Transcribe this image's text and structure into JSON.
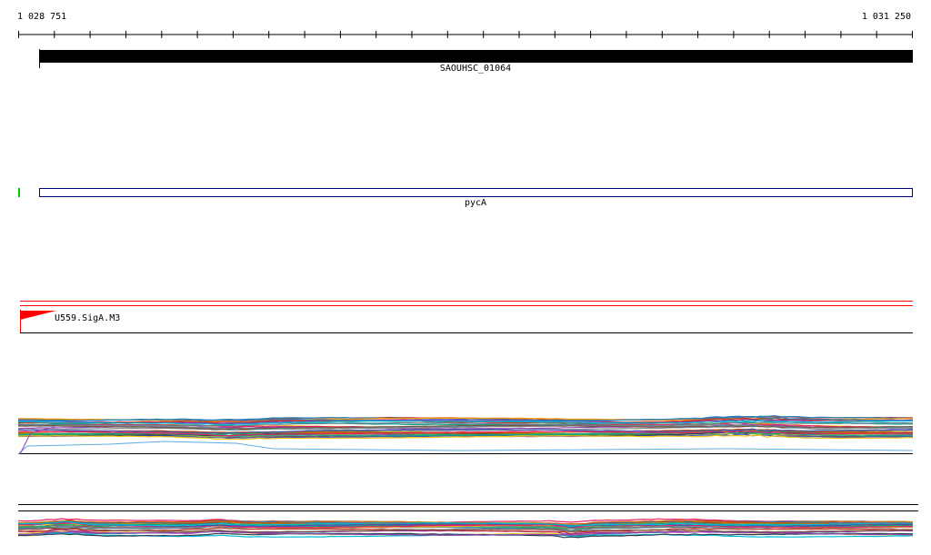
{
  "ruler": {
    "start_label": "1 028 751",
    "end_label": "1 031 250",
    "start": 1028751,
    "end": 1031250
  },
  "tracks": {
    "gene_1": {
      "name": "SAOUHSC_01064",
      "color": "#000000"
    },
    "gene_2": {
      "name": "pycA",
      "color": "#000080",
      "marker_color": "#00cc00"
    },
    "motif": {
      "name": "U559.SigA.M3",
      "color": "#ff0000"
    }
  },
  "colors": {
    "background": "#ffffff",
    "axis": "#000000",
    "motif_lines": "#ff0000",
    "palette": [
      "#c0392b",
      "#27ae60",
      "#2980b9",
      "#8e44ad",
      "#d35400",
      "#16a085",
      "#7f8c8d",
      "#f1c40f",
      "#e91e63",
      "#795548",
      "#3f51b5",
      "#00bcd4",
      "#8bc34a",
      "#ff9800",
      "#9c27b0",
      "#607d8b",
      "#2c3e50",
      "#b8860b"
    ]
  }
}
